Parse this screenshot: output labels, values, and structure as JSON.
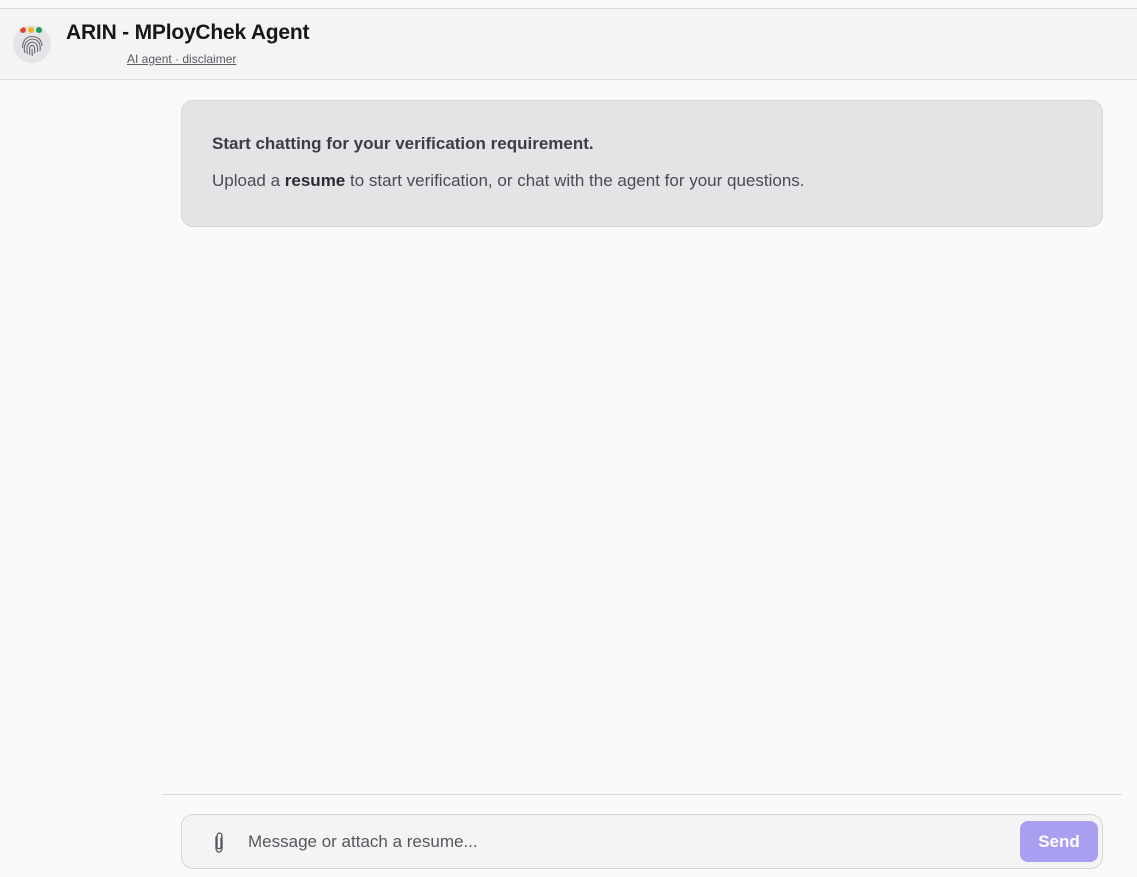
{
  "header": {
    "title": "ARIN - MPloyChek Agent",
    "subtitle": "AI agent · disclaimer",
    "avatar_icon": "fingerprint-icon",
    "avatar_dot_colors": [
      "#e0473a",
      "#f2b21b",
      "#1b9b5a"
    ]
  },
  "welcome": {
    "heading": "Start chatting for your verification requirement.",
    "body_prefix": "Upload a ",
    "body_bold": "resume",
    "body_suffix": " to start verification, or chat with the agent for your questions."
  },
  "composer": {
    "placeholder": "Message or attach a resume...",
    "value": "",
    "attach_icon": "paperclip-icon",
    "send_label": "Send",
    "send_color": "#a99ff0"
  }
}
